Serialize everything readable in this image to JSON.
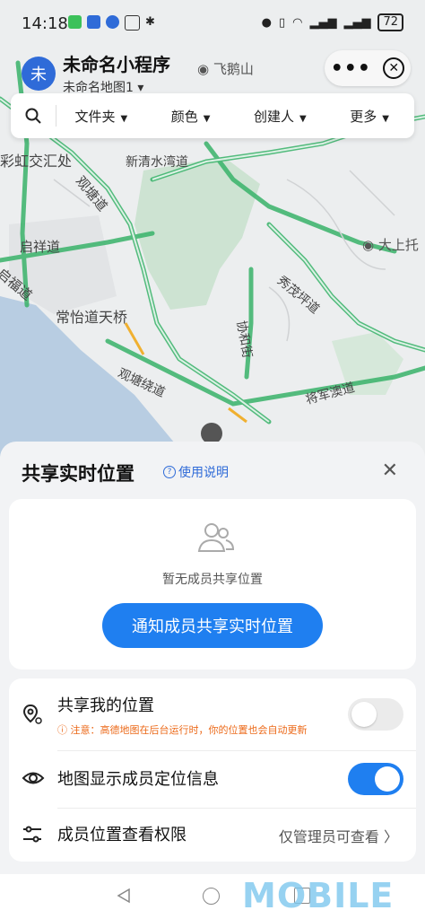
{
  "status_bar": {
    "time": "14:18",
    "battery": "72"
  },
  "header": {
    "avatar_char": "未",
    "app_title": "未命名小程序",
    "map_name": "未命名地图1 ▾",
    "more_label": "•••"
  },
  "filters": [
    {
      "label": "文件夹"
    },
    {
      "label": "颜色"
    },
    {
      "label": "创建人"
    },
    {
      "label": "更多"
    }
  ],
  "map": {
    "labels": [
      "飞鹅山",
      "彩虹交汇处",
      "新清水湾道",
      "观塘道",
      "启祥道",
      "启福道",
      "常怡道天桥",
      "大上托",
      "秀茂坪道",
      "协和街",
      "观塘绕道",
      "将军澳道"
    ]
  },
  "sheet": {
    "title": "共享实时位置",
    "help": "使用说明",
    "empty_text": "暂无成员共享位置",
    "notify_button": "通知成员共享实时位置",
    "rows": [
      {
        "label": "共享我的位置",
        "note": "注意：高德地图在后台运行时，你的位置也会自动更新",
        "enabled": false
      },
      {
        "label": "地图显示成员定位信息",
        "enabled": true
      },
      {
        "label": "成员位置查看权限",
        "value": "仅管理员可查看"
      }
    ]
  },
  "watermark": "MOBILE",
  "colors": {
    "accent": "#1f7ff0",
    "road": "#39b36a",
    "warning": "#ec6a1a"
  }
}
